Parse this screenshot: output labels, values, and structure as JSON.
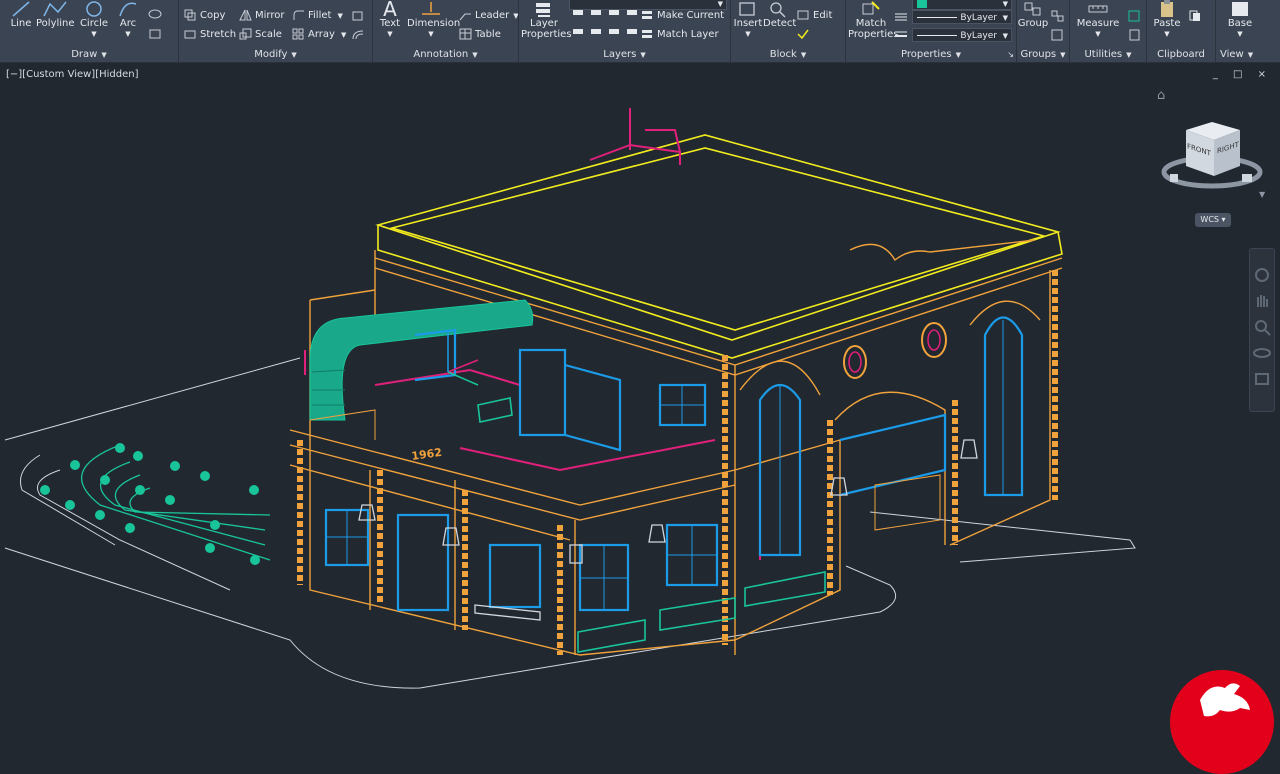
{
  "ribbon": {
    "draw": {
      "title": "Draw",
      "line": "Line",
      "polyline": "Polyline",
      "circle": "Circle",
      "arc": "Arc"
    },
    "modify": {
      "title": "Modify",
      "copy": "Copy",
      "stretch": "Stretch",
      "mirror": "Mirror",
      "scale": "Scale",
      "fillet": "Fillet",
      "array": "Array"
    },
    "annotation": {
      "title": "Annotation",
      "text": "Text",
      "dimension": "Dimension",
      "leader": "Leader",
      "table": "Table"
    },
    "layers": {
      "title": "Layers",
      "layer_properties": "Layer Properties",
      "make_current": "Make Current",
      "match_layer": "Match Layer"
    },
    "block": {
      "title": "Block",
      "insert": "Insert",
      "detect": "Detect",
      "edit": "Edit"
    },
    "properties": {
      "title": "Properties",
      "match_properties": "Match Properties",
      "linetype": "ByLayer",
      "lineweight": "ByLayer"
    },
    "groups": {
      "title": "Groups",
      "group": "Group"
    },
    "utilities": {
      "title": "Utilities",
      "measure": "Measure"
    },
    "clipboard": {
      "title": "Clipboard",
      "paste": "Paste"
    },
    "view": {
      "title": "View",
      "base": "Base"
    }
  },
  "viewport": {
    "label": "[−][Custom View][Hidden]",
    "controls": "_ □ ×"
  },
  "viewcube": {
    "front": "FRONT",
    "right": "RIGHT",
    "wcs": "WCS"
  },
  "sign_text": "1962",
  "colors": {
    "ribbon_bg": "#3b4453",
    "viewport_bg": "#212830",
    "wire_yellow": "#f2ec1f",
    "wire_orange": "#f0a23c",
    "wire_blue": "#1c9be8",
    "wire_green": "#19c49a",
    "wire_magenta": "#e0207a",
    "wire_white": "#cfd6dd",
    "logo_red": "#e3001b"
  }
}
